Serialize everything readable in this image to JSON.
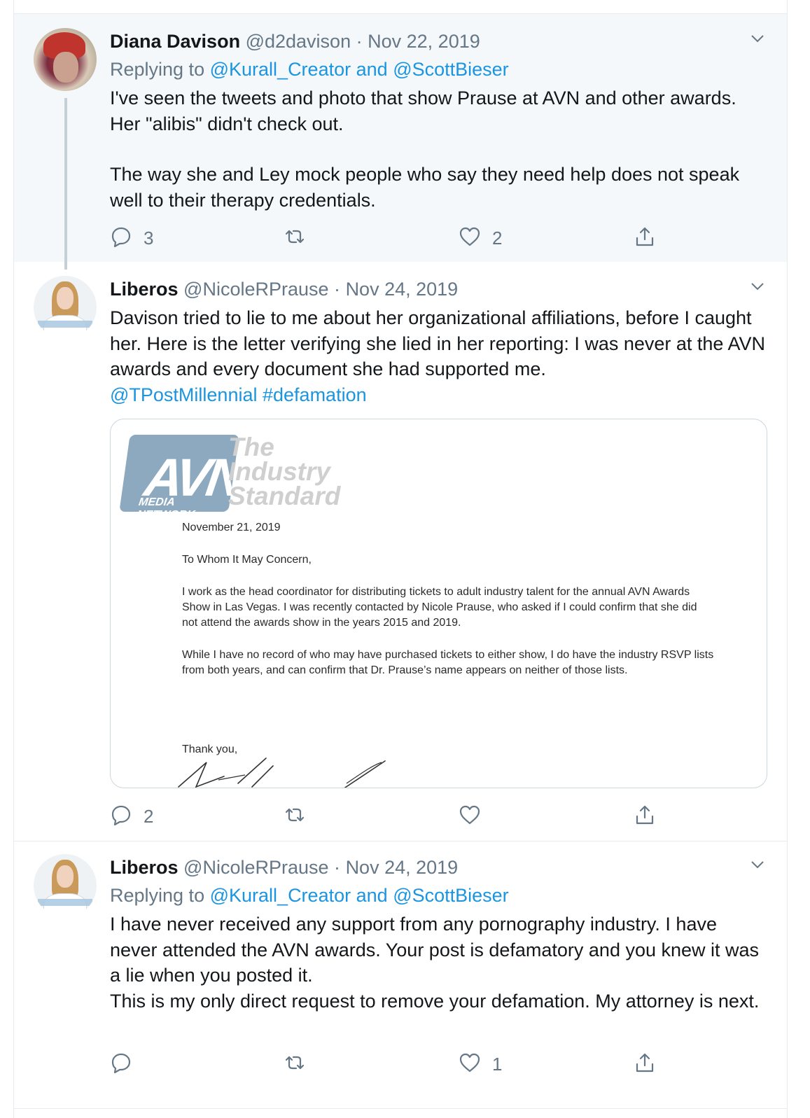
{
  "tweets": [
    {
      "name": "Diana Davison",
      "handle": "@d2davison",
      "date": "Nov 22, 2019",
      "replying_prefix": "Replying to",
      "replying_to_1": "@Kurall_Creator",
      "replying_and": "and",
      "replying_to_2": "@ScottBieser",
      "body_lines": [
        "I've seen the tweets and photo that show Prause at AVN and other awards. Her \"alibis\" didn't check out.",
        "The way she and Ley mock people who say they need help does not speak well to their therapy credentials."
      ],
      "reply_count": "3",
      "retweet_count": "",
      "like_count": "2"
    },
    {
      "name": "Liberos",
      "handle": "@NicoleRPrause",
      "date": "Nov 24, 2019",
      "body": "Davison tried to lie to me about her organizational affiliations, before I caught her. Here is the letter verifying she lied in her reporting: I was never at the AVN awards and every document she had supported me.",
      "mention": "@TPostMillennial",
      "hashtag": "#defamation",
      "reply_count": "2",
      "retweet_count": "",
      "like_count": ""
    },
    {
      "name": "Liberos",
      "handle": "@NicoleRPrause",
      "date": "Nov 24, 2019",
      "replying_prefix": "Replying to",
      "replying_to_1": "@Kurall_Creator",
      "replying_and": "and",
      "replying_to_2": "@ScottBieser",
      "body_lines": [
        "I have never received any support from any pornography industry. I have never attended the AVN awards. Your post is defamatory and you knew it was a lie when you posted it.",
        "This is my only direct request to remove your defamation. My attorney is next."
      ],
      "reply_count": "",
      "retweet_count": "",
      "like_count": "1"
    }
  ],
  "letter": {
    "logo_text": "AVN",
    "logo_subtext": "MEDIA NETWORK",
    "tagline_1": "The",
    "tagline_2": "Industry",
    "tagline_3": "Standard",
    "date": "November 21, 2019",
    "salutation": "To Whom It May Concern,",
    "paragraph_1": "I work as the head coordinator for distributing tickets to adult industry talent for the annual AVN Awards Show in Las Vegas. I was recently contacted by Nicole Prause, who asked if I could confirm that she did not attend the awards show in the years 2015 and 2019.",
    "paragraph_2": "While I have no record of who may have purchased tickets to either show, I do have the industry RSVP lists from both years, and can confirm that Dr. Prause’s name appears on neither of those lists.",
    "closing": "Thank you,"
  },
  "icons": [
    "reply-icon",
    "retweet-icon",
    "like-icon",
    "share-icon",
    "chevron-down-icon"
  ],
  "colors": {
    "link": "#1b95e0",
    "meta": "#657786",
    "highlight_bg": "#f5f8fa",
    "divider": "#e6ecf0"
  }
}
